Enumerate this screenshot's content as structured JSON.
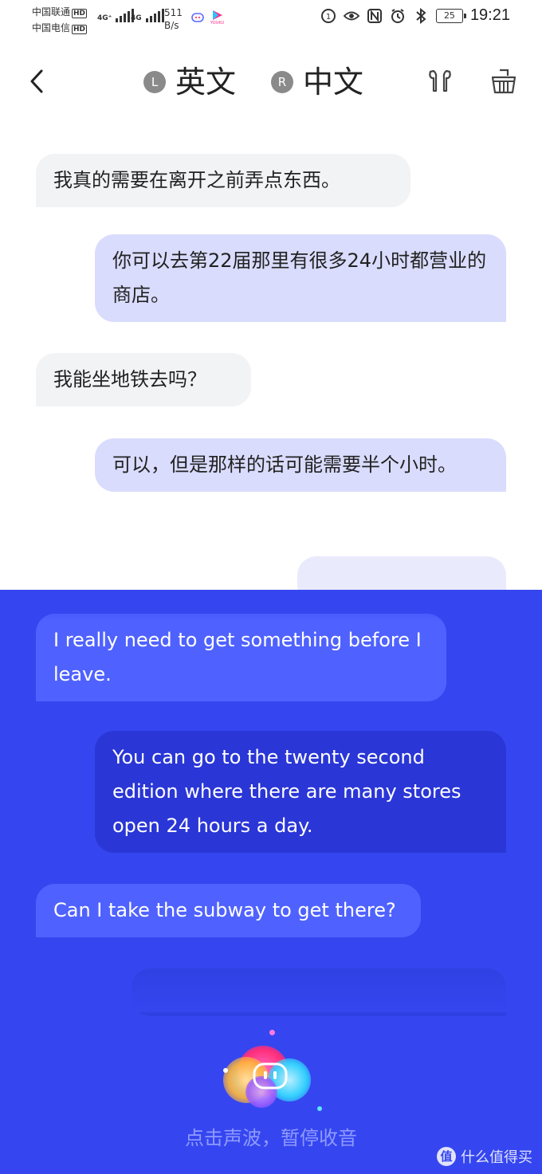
{
  "status_bar": {
    "carrier1": "中国联通",
    "carrier2": "中国电信",
    "hd": "HD",
    "net1": "4G⁺",
    "net2": "4G",
    "speed_value": "511",
    "speed_unit": "B/s",
    "app_label": "YOUKU",
    "battery": "25",
    "time": "19:21"
  },
  "header": {
    "left_badge": "L",
    "left_lang": "英文",
    "right_badge": "R",
    "right_lang": "中文"
  },
  "chat_zh": [
    {
      "side": "left",
      "text": "我真的需要在离开之前弄点东西。"
    },
    {
      "side": "right",
      "text": "你可以去第22届那里有很多24小时都营业的商店。"
    },
    {
      "side": "left",
      "text": "我能坐地铁去吗？"
    },
    {
      "side": "right",
      "text": "可以，但是那样的话可能需要半个小时。"
    }
  ],
  "chat_en": [
    {
      "side": "left",
      "text": "I really need to get something before I leave."
    },
    {
      "side": "right",
      "text": "You can go to the twenty second edition where there are many stores open 24 hours a day."
    },
    {
      "side": "left",
      "text": "Can I take the subway to get there?"
    }
  ],
  "hint": "点击声波，暂停收音",
  "watermark": "值 什么值得买",
  "colors": {
    "panel_bg": "#3546f0",
    "bubble_left_en": "#4f62ff",
    "bubble_right_en": "#2a36d6",
    "bubble_right_zh": "#d9dcfc",
    "bubble_left_zh": "#f2f3f5"
  }
}
